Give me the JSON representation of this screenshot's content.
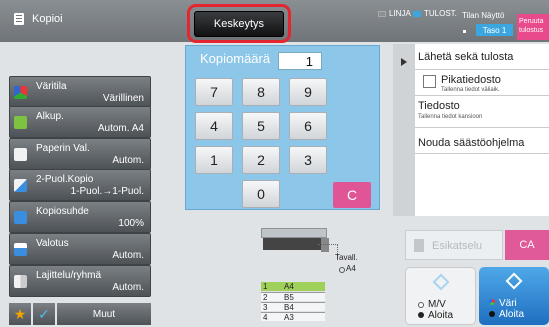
{
  "header": {
    "mode_label": "Kopioi",
    "stop_label": "Keskeytys",
    "status_linja": "LINJA",
    "status_tulost": "TULOST.",
    "tilan_naytto": "Tilan Näyttö",
    "taso_label": "Taso 1",
    "cancel_label": "Peruuta tulostus",
    "colors": {
      "status_blue": "#3ca6e0",
      "cancel_pink": "#e84a8b",
      "highlight_red": "#e3262f"
    }
  },
  "left_menu": [
    {
      "title": "Väritila",
      "value": "Värillinen",
      "icon": "color-mode-icon"
    },
    {
      "title": "Alkup.",
      "value": "Autom.  A4",
      "icon": "original-icon"
    },
    {
      "title": "Paperin Val.",
      "value": "Autom.",
      "icon": "paper-icon"
    },
    {
      "title": "2-Puol.Kopio",
      "value": "1-Puol.→1-Puol.",
      "icon": "duplex-icon"
    },
    {
      "title": "Kopiosuhde",
      "value": "100%",
      "icon": "ratio-icon"
    },
    {
      "title": "Valotus",
      "value": "Autom.",
      "icon": "exposure-icon"
    },
    {
      "title": "Lajittelu/ryhmä",
      "value": "Autom.",
      "icon": "sort-icon"
    }
  ],
  "bottom_left": {
    "more_label": "Muut",
    "star_icon": "star-icon",
    "check_icon": "checkmark-icon"
  },
  "keypad": {
    "label": "Kopiomäärä",
    "value": "1",
    "keys": [
      "7",
      "8",
      "9",
      "4",
      "5",
      "6",
      "1",
      "2",
      "3",
      "0"
    ],
    "clear_label": "C"
  },
  "right_panel": {
    "send_print": "Lähetä sekä tulosta",
    "quick_file": "Pikatiedosto",
    "quick_file_sub": "Tallenna tiedot väliaik.",
    "file": "Tiedosto",
    "file_sub": "Tallenna tiedot kansioon",
    "eco_program": "Nouda säästöohjelma"
  },
  "preview": {
    "tavall": "Tavall.",
    "tavall_size": "A4",
    "trays": [
      {
        "num": "1",
        "size": "A4"
      },
      {
        "num": "2",
        "size": "B5"
      },
      {
        "num": "3",
        "size": "B4"
      },
      {
        "num": "4",
        "size": "A3"
      }
    ]
  },
  "actions": {
    "preview_label": "Esikatselu",
    "ca_label": "CA",
    "mv_start": "M/V\nAloita",
    "mv_line1": "M/V",
    "mv_line2": "Aloita",
    "color_line1": "Väri",
    "color_line2": "Aloita"
  }
}
